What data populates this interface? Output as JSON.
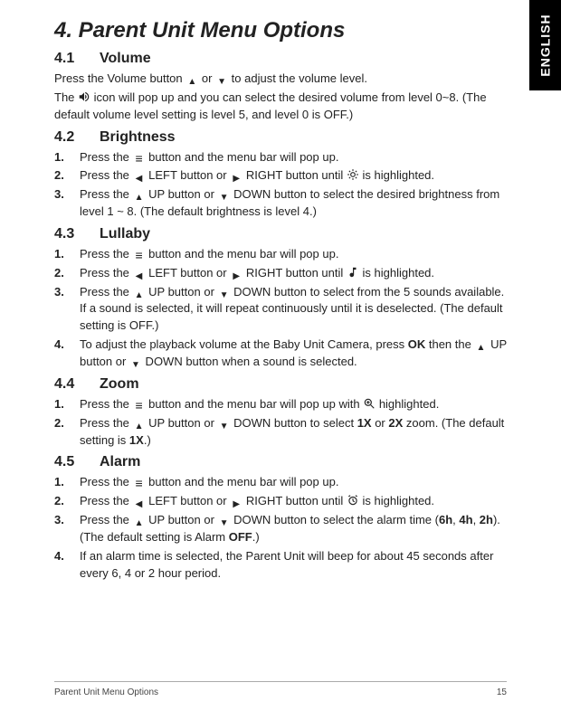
{
  "langTab": "ENGLISH",
  "title": "4. Parent Unit Menu Options",
  "s41": {
    "heading_num": "4.1",
    "heading_text": "Volume",
    "p1a": "Press the Volume button ",
    "p1b": " or ",
    "p1c": " to adjust the volume level.",
    "p2a": "The ",
    "p2b": " icon will pop up and you can select the desired volume from level 0~8. (The default volume level setting is level 5, and level 0 is OFF.)"
  },
  "s42": {
    "heading_num": "4.2",
    "heading_text": "Brightness",
    "i1a": "Press the ",
    "i1b": " button and the menu bar will pop up.",
    "i2a": "Press the ",
    "i2b": " LEFT button or ",
    "i2c": " RIGHT button until ",
    "i2d": " is highlighted.",
    "i3a": "Press the ",
    "i3b": " UP button or ",
    "i3c": " DOWN button to select the desired brightness from level 1 ~ 8. (The default brightness is level 4.)"
  },
  "s43": {
    "heading_num": "4.3",
    "heading_text": "Lullaby",
    "i1a": "Press the ",
    "i1b": " button and the menu bar will pop up.",
    "i2a": "Press the ",
    "i2b": " LEFT button or ",
    "i2c": " RIGHT button until ",
    "i2d": " is highlighted.",
    "i3a": "Press the ",
    "i3b": " UP button or ",
    "i3c": " DOWN button to select from the 5 sounds available. If a sound is selected, it will repeat continuously until it is deselected. (The default setting is OFF.)",
    "i4a": "To adjust the playback volume at the Baby Unit Camera, press ",
    "i4ok": "OK",
    "i4b": " then the ",
    "i4c": " UP button or ",
    "i4d": " DOWN button when a sound is selected."
  },
  "s44": {
    "heading_num": "4.4",
    "heading_text": "Zoom",
    "i1a": "Press the ",
    "i1b": " button and the menu bar will pop up with ",
    "i1c": " highlighted.",
    "i2a": "Press the ",
    "i2b": " UP button or ",
    "i2c": " DOWN button to select ",
    "i2x1": "1X",
    "i2d": " or ",
    "i2x2": "2X",
    "i2e": " zoom. (The default setting is ",
    "i2x3": "1X",
    "i2f": ".)"
  },
  "s45": {
    "heading_num": "4.5",
    "heading_text": "Alarm",
    "i1a": "Press the ",
    "i1b": " button and the menu bar will pop up.",
    "i2a": "Press the ",
    "i2b": " LEFT button or ",
    "i2c": " RIGHT button until ",
    "i2d": " is highlighted.",
    "i3a": "Press the ",
    "i3b": " UP button or ",
    "i3c": " DOWN button to select the alarm time (",
    "i3h6": "6h",
    "i3s1": ", ",
    "i3h4": "4h",
    "i3s2": ", ",
    "i3h2": "2h",
    "i3d": "). (The default setting is Alarm ",
    "i3off": "OFF",
    "i3e": ".)",
    "i4": "If an alarm time is selected, the Parent Unit will beep for about 45 seconds after every 6, 4 or 2 hour period."
  },
  "footer": {
    "left": "Parent Unit Menu Options",
    "right": "15"
  },
  "nums": {
    "n1": "1.",
    "n2": "2.",
    "n3": "3.",
    "n4": "4."
  }
}
